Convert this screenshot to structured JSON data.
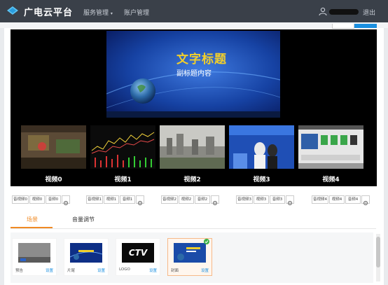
{
  "header": {
    "brand": "广电云平台",
    "nav": [
      "服务管理",
      "账户管理"
    ],
    "logout": "退出"
  },
  "preview": {
    "title": "文字标题",
    "subtitle": "副标题内容"
  },
  "videos": [
    {
      "label": "视频0",
      "buttons": [
        "音视频0",
        "视频0",
        "音频0"
      ]
    },
    {
      "label": "视频1",
      "buttons": [
        "音视频1",
        "视频1",
        "音频1"
      ]
    },
    {
      "label": "视频2",
      "buttons": [
        "音视频2",
        "视频2",
        "音频2"
      ]
    },
    {
      "label": "视频3",
      "buttons": [
        "音视频3",
        "视频3",
        "音频3"
      ]
    },
    {
      "label": "视频4",
      "buttons": [
        "音视频4",
        "视频4",
        "音频4"
      ]
    }
  ],
  "tabs": {
    "scene": "场景",
    "volume": "音量调节"
  },
  "scenes": [
    {
      "name": "预告",
      "settings": "设置"
    },
    {
      "name": "片尾",
      "settings": "设置"
    },
    {
      "name": "LOGO",
      "settings": "设置",
      "logo_text": "CTV"
    },
    {
      "name": "封面",
      "settings": "设置",
      "selected": true
    }
  ],
  "colors": {
    "topbar": "#3a4049",
    "accent_orange": "#f08a24",
    "link_blue": "#1a8fe0",
    "preview_title": "#f2cf2b"
  }
}
